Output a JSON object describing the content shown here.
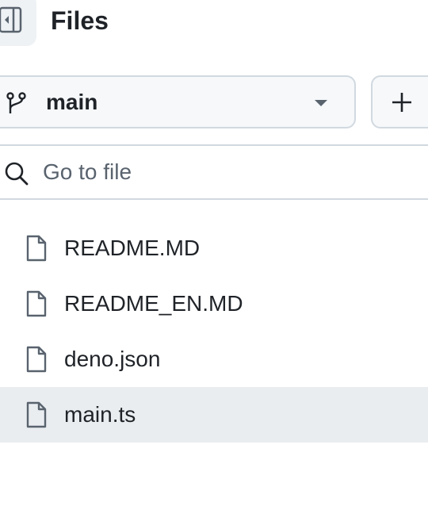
{
  "header": {
    "title": "Files",
    "collapse_icon": "sidebar-collapse-icon"
  },
  "branch": {
    "icon": "git-branch-icon",
    "label": "main",
    "caret_icon": "triangle-down-icon"
  },
  "add_button": {
    "icon": "plus-icon"
  },
  "search": {
    "icon": "search-icon",
    "placeholder": "Go to file",
    "value": ""
  },
  "files": [
    {
      "name": "README.MD",
      "icon": "file-icon",
      "selected": false
    },
    {
      "name": "README_EN.MD",
      "icon": "file-icon",
      "selected": false
    },
    {
      "name": "deno.json",
      "icon": "file-icon",
      "selected": false
    },
    {
      "name": "main.ts",
      "icon": "file-icon",
      "selected": true
    }
  ],
  "colors": {
    "text": "#1f2328",
    "muted": "#59636e",
    "border": "#d1d9e0",
    "button_bg": "#f6f8fa",
    "selected_bg": "#eaedf0"
  }
}
